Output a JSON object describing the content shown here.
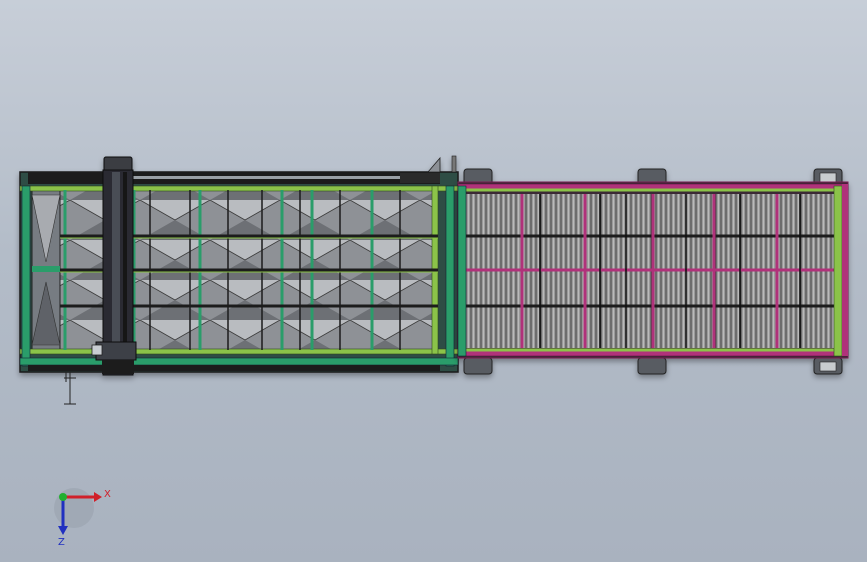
{
  "view": {
    "background_top": "#c7ced8",
    "background_bottom": "#a9b2bf"
  },
  "colors": {
    "frame_green": "#2a9d6a",
    "frame_lime": "#8bc34a",
    "magenta": "#b0307a",
    "dark": "#1e1e1e",
    "grid_gray": "#7d7d7d"
  },
  "triad": {
    "x_label": "X",
    "z_label": "Z",
    "x_color": "#d0202a",
    "y_color": "#20b030",
    "z_color": "#2030c0"
  }
}
